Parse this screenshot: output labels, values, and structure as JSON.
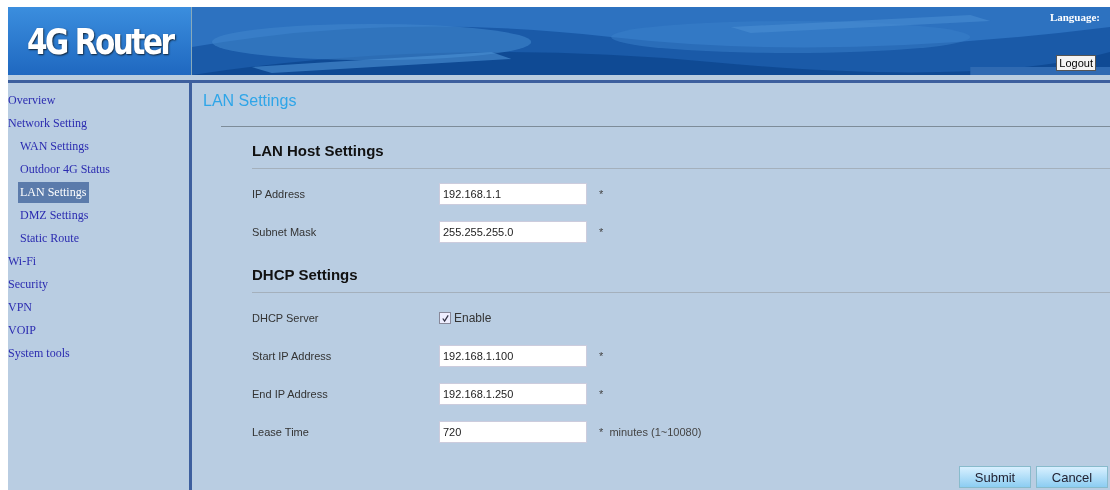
{
  "header": {
    "logo": "4G Router",
    "language_label": "Language:",
    "logout": "Logout"
  },
  "sidebar": {
    "items": [
      {
        "label": "Overview",
        "selected": false
      },
      {
        "label": "Network Setting",
        "selected": false,
        "children": [
          {
            "label": "WAN Settings",
            "selected": false
          },
          {
            "label": "Outdoor 4G Status",
            "selected": false
          },
          {
            "label": "LAN Settings",
            "selected": true
          },
          {
            "label": "DMZ Settings",
            "selected": false
          },
          {
            "label": "Static Route",
            "selected": false
          }
        ]
      },
      {
        "label": "Wi-Fi",
        "selected": false
      },
      {
        "label": "Security",
        "selected": false
      },
      {
        "label": "VPN",
        "selected": false
      },
      {
        "label": "VOIP",
        "selected": false
      },
      {
        "label": "System tools",
        "selected": false
      }
    ]
  },
  "page_title": "LAN Settings",
  "sections": [
    {
      "title": "LAN Host Settings",
      "rows": [
        {
          "kind": "text",
          "label": "IP Address",
          "value": "192.168.1.1",
          "note": "*"
        },
        {
          "kind": "text",
          "label": "Subnet Mask",
          "value": "255.255.255.0",
          "note": "*"
        }
      ]
    },
    {
      "title": "DHCP Settings",
      "rows": [
        {
          "kind": "checkbox",
          "label": "DHCP Server",
          "option": "Enable",
          "checked": true
        },
        {
          "kind": "text",
          "label": "Start IP Address",
          "value": "192.168.1.100",
          "note": "*"
        },
        {
          "kind": "text",
          "label": "End IP Address",
          "value": "192.168.1.250",
          "note": "*"
        },
        {
          "kind": "text",
          "label": "Lease Time",
          "value": "720",
          "note": "*  minutes (1~10080)"
        }
      ]
    }
  ],
  "buttons": [
    "Submit",
    "Cancel"
  ]
}
